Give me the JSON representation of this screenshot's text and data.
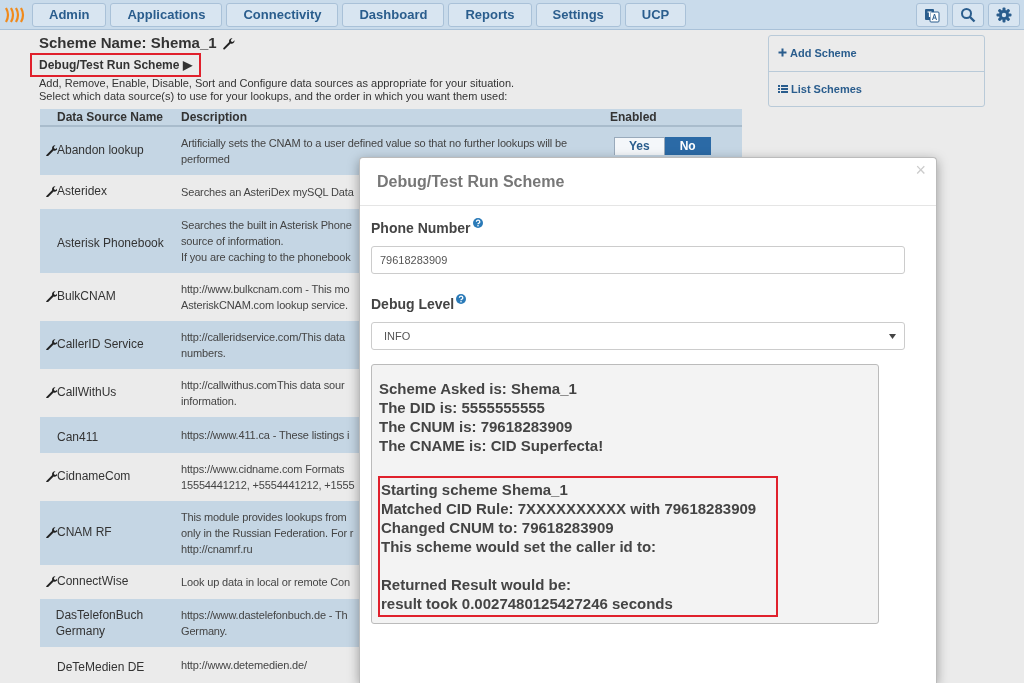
{
  "navbar": {
    "menus": [
      {
        "label": "Admin"
      },
      {
        "label": "Applications"
      },
      {
        "label": "Connectivity"
      },
      {
        "label": "Dashboard"
      },
      {
        "label": "Reports"
      },
      {
        "label": "Settings"
      },
      {
        "label": "UCP"
      }
    ]
  },
  "scheme": {
    "title": "Scheme Name: Shema_1",
    "debug_link": "Debug/Test Run Scheme ▶",
    "instructions": [
      "Add, Remove, Enable, Disable, Sort and Configure data sources as appropriate for your situation.",
      "Select which data source(s) to use for your lookups, and the order in which you want them used:"
    ]
  },
  "sidebar": {
    "items": [
      {
        "label": "Add Scheme",
        "kind": "add"
      },
      {
        "label": "List Schemes",
        "kind": "list"
      }
    ]
  },
  "table": {
    "columns": [
      "Data Source Name",
      "Description",
      "Enabled"
    ],
    "rows": [
      {
        "name": "Abandon lookup",
        "configurable": true,
        "description": [
          "Artificially sets the CNAM to a user defined value so that no further lookups will be",
          "performed"
        ],
        "toggle": [
          {
            "label": "Yes",
            "selected": false
          },
          {
            "label": "No",
            "selected": true
          }
        ]
      },
      {
        "name": "Asteridex",
        "configurable": true,
        "description": [
          "Searches an AsteriDex mySQL Data"
        ]
      },
      {
        "name": "Asterisk Phonebook",
        "configurable": false,
        "description": [
          "Searches the built in Asterisk Phone",
          "source of information.",
          "If you are caching to the phonebook"
        ]
      },
      {
        "name": "BulkCNAM",
        "configurable": true,
        "description": [
          "http://www.bulkcnam.com - This mo",
          "AsteriskCNAM.com lookup service."
        ]
      },
      {
        "name": "CallerID Service",
        "configurable": true,
        "description": [
          "http://calleridservice.com/This data",
          "numbers."
        ]
      },
      {
        "name": "CallWithUs",
        "configurable": true,
        "description": [
          "http://callwithus.comThis data sour",
          "information."
        ]
      },
      {
        "name": "Can411",
        "configurable": false,
        "description": [
          "https://www.411.ca - These listings i"
        ]
      },
      {
        "name": "CidnameCom",
        "configurable": true,
        "description": [
          "https://www.cidname.com Formats",
          "15554441212, +5554441212, +1555"
        ]
      },
      {
        "name": "CNAM RF",
        "configurable": true,
        "description": [
          "This module provides lookups from",
          "only in the Russian Federation. For r",
          "http://cnamrf.ru"
        ]
      },
      {
        "name": "ConnectWise",
        "configurable": true,
        "description": [
          "Look up data in local or remote Con"
        ]
      },
      {
        "name": "DasTelefonBuch Germany",
        "configurable": false,
        "description": [
          "https://www.dastelefonbuch.de - Th",
          "Germany."
        ]
      },
      {
        "name": "DeTeMedien DE",
        "configurable": false,
        "description": [
          "http://www.detemedien.de/"
        ]
      }
    ]
  },
  "modal": {
    "title": "Debug/Test Run Scheme",
    "close": "×",
    "fields": [
      {
        "kind": "input",
        "label": "Phone Number",
        "value": "79618283909"
      },
      {
        "kind": "select",
        "label": "Debug Level",
        "value": "INFO"
      }
    ],
    "output": [
      {
        "highlighted": false,
        "paragraphs": [
          [
            "Scheme Asked is: Shema_1",
            "The DID is: 5555555555",
            "The CNUM is: 79618283909",
            "The CNAME is: CID Superfecta!"
          ]
        ]
      },
      {
        "highlighted": true,
        "paragraphs": [
          [
            "Starting scheme Shema_1",
            "Matched CID Rule: 7XXXXXXXXXX with 79618283909",
            "Changed CNUM to: 79618283909",
            "This scheme would set the caller id to:"
          ],
          [
            "Returned Result would be:",
            "result took 0.0027480125427246 seconds"
          ]
        ]
      }
    ]
  }
}
